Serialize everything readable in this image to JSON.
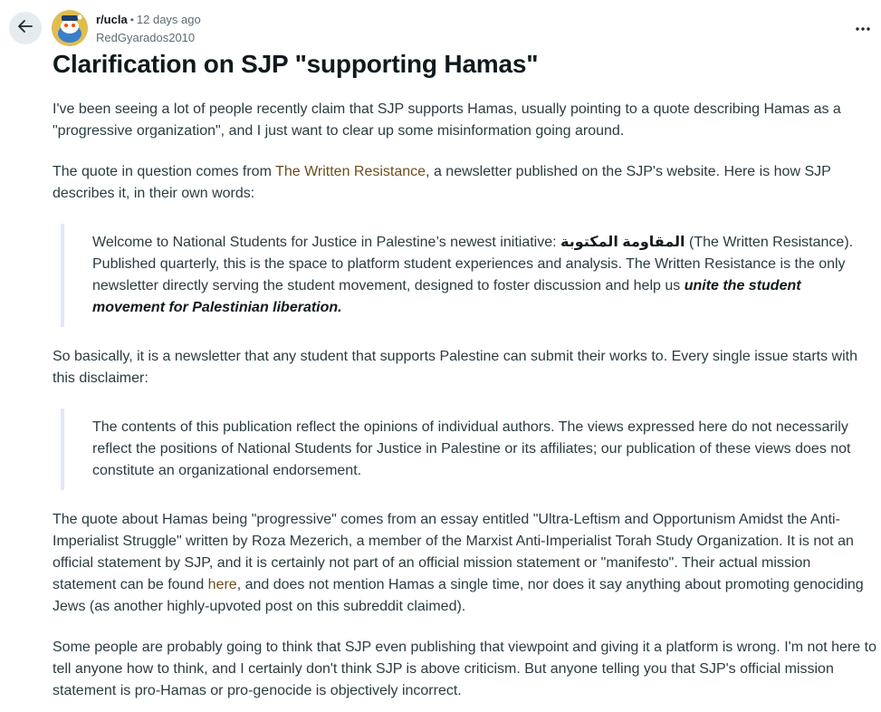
{
  "header": {
    "subreddit": "r/ucla",
    "separator": "•",
    "time_ago": "12 days ago",
    "username": "RedGyarados2010"
  },
  "icons": {
    "back": "arrow-left-icon",
    "more": "more-horizontal-icon",
    "avatar": "user-avatar-icon"
  },
  "post": {
    "title": "Clarification on SJP \"supporting Hamas\"",
    "p1": "I've been seeing a lot of people recently claim that SJP supports Hamas, usually pointing to a quote describing Hamas as a \"progressive organization\", and I just want to clear up some misinformation going around.",
    "p2_before": "The quote in question comes from ",
    "p2_link": "The Written Resistance",
    "p2_after": ", a newsletter published on the SJP's website. Here is how SJP describes it, in their own words:",
    "q1_before": "Welcome to National Students for Justice in Palestine’s newest initiative: ",
    "q1_arabic": "المقاومة المكتوبة",
    "q1_middle": " (The Written Resistance). Published quarterly, this is the space to platform student experiences and analysis. The Written Resistance is the only newsletter directly serving the student movement, designed to foster discussion and help us ",
    "q1_emph": "unite the student movement for Palestinian liberation.",
    "p3": "So basically, it is a newsletter that any student that supports Palestine can submit their works to. Every single issue starts with this disclaimer:",
    "q2": "The contents of this publication reflect the opinions of individual authors. The views expressed here do not necessarily reflect the positions of National Students for Justice in Palestine or its affiliates; our publication of these views does not constitute an organizational endorsement.",
    "p4_before": "The quote about Hamas being \"progressive\" comes from an essay entitled \"Ultra-Leftism and Opportunism Amidst the Anti-Imperialist Struggle\" written by Roza Mezerich, a member of the Marxist Anti-Imperialist Torah Study Organization. It is not an official statement by SJP, and it is certainly not part of an official mission statement or \"manifesto\". Their actual mission statement can be found ",
    "p4_link": "here",
    "p4_after": ", and does not mention Hamas a single time, nor does it say anything about promoting genociding Jews (as another highly-upvoted post on this subreddit claimed).",
    "p5": "Some people are probably going to think that SJP even publishing that viewpoint and giving it a platform is wrong. I'm not here to tell anyone how to think, and I certainly don't think SJP is above criticism. But anyone telling you that SJP's official mission statement is pro-Hamas or pro-genocide is objectively incorrect."
  },
  "colors": {
    "link": "#6b4f1d",
    "text": "#2a3c42",
    "quote_border": "#e2e7f6",
    "back_button_bg": "#e5ebee"
  }
}
